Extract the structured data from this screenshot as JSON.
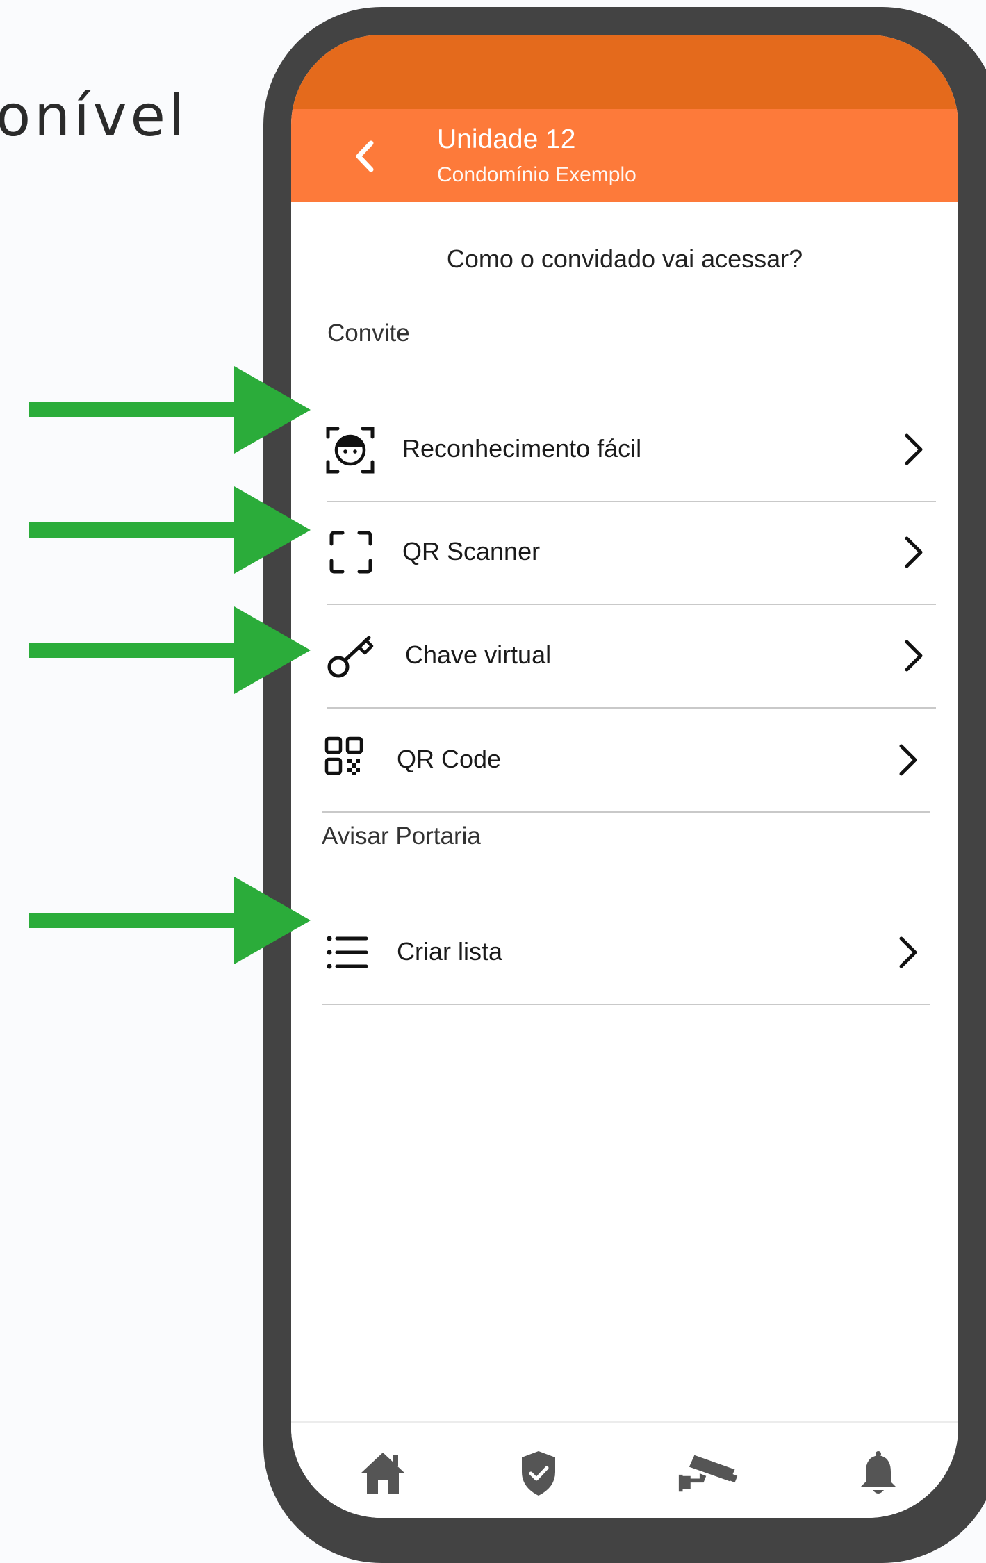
{
  "background": {
    "title": "onível"
  },
  "header": {
    "title": "Unidade 12",
    "subtitle": "Condomínio Exemplo",
    "back_icon": "chevron-left-icon",
    "color": "#fd7a3a",
    "status_color": "#e46a1c"
  },
  "question": "Como o convidado vai acessar?",
  "sections": {
    "convite": {
      "label": "Convite",
      "items": [
        {
          "label": "Reconhecimento fácil",
          "icon": "face-recognition-icon"
        },
        {
          "label": "QR Scanner",
          "icon": "scan-frame-icon"
        },
        {
          "label": "Chave virtual",
          "icon": "key-icon"
        },
        {
          "label": "QR Code",
          "icon": "qr-code-icon"
        }
      ]
    },
    "avisar": {
      "label": "Avisar Portaria",
      "items": [
        {
          "label": "Criar lista",
          "icon": "list-icon"
        }
      ]
    }
  },
  "tabs": [
    {
      "name": "home",
      "icon": "home-icon"
    },
    {
      "name": "security",
      "icon": "shield-check-icon"
    },
    {
      "name": "cameras",
      "icon": "cctv-camera-icon"
    },
    {
      "name": "notifications",
      "icon": "bell-icon"
    }
  ],
  "annotation_color": "#2bac3a"
}
